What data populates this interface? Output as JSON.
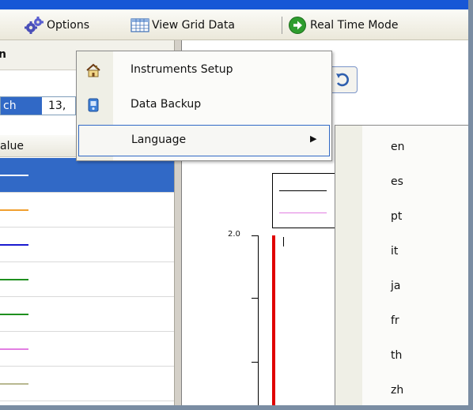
{
  "toolbar": {
    "options_label": "Options",
    "view_grid_label": "View Grid Data",
    "real_time_label": "Real Time Mode"
  },
  "left_panel": {
    "header_fragment": "n",
    "date_fragment_selected": "ch",
    "date_fragment_rest": "13,",
    "column_header": "alue",
    "rows": [
      {
        "color": "#ffffff",
        "selected": true
      },
      {
        "color": "#f0a030",
        "selected": false
      },
      {
        "color": "#1a1ad0",
        "selected": false
      },
      {
        "color": "#1f8f1f",
        "selected": false
      },
      {
        "color": "#1f8f1f",
        "selected": false
      },
      {
        "color": "#e27ee2",
        "selected": false
      },
      {
        "color": "#b8b890",
        "selected": false
      }
    ]
  },
  "chart": {
    "y_top_tick": "2.0"
  },
  "options_menu": {
    "items": [
      {
        "label": "Instruments Setup",
        "icon": "house-icon"
      },
      {
        "label": "Data Backup",
        "icon": "backup-icon"
      },
      {
        "label": "Language",
        "icon": "",
        "has_submenu": true
      }
    ]
  },
  "language_submenu": {
    "items": [
      "en",
      "es",
      "pt",
      "it",
      "ja",
      "fr",
      "th",
      "zh"
    ]
  },
  "colors": {
    "selection": "#3169c6",
    "title_bar": "#1657d6",
    "plot_red": "#e00000"
  }
}
